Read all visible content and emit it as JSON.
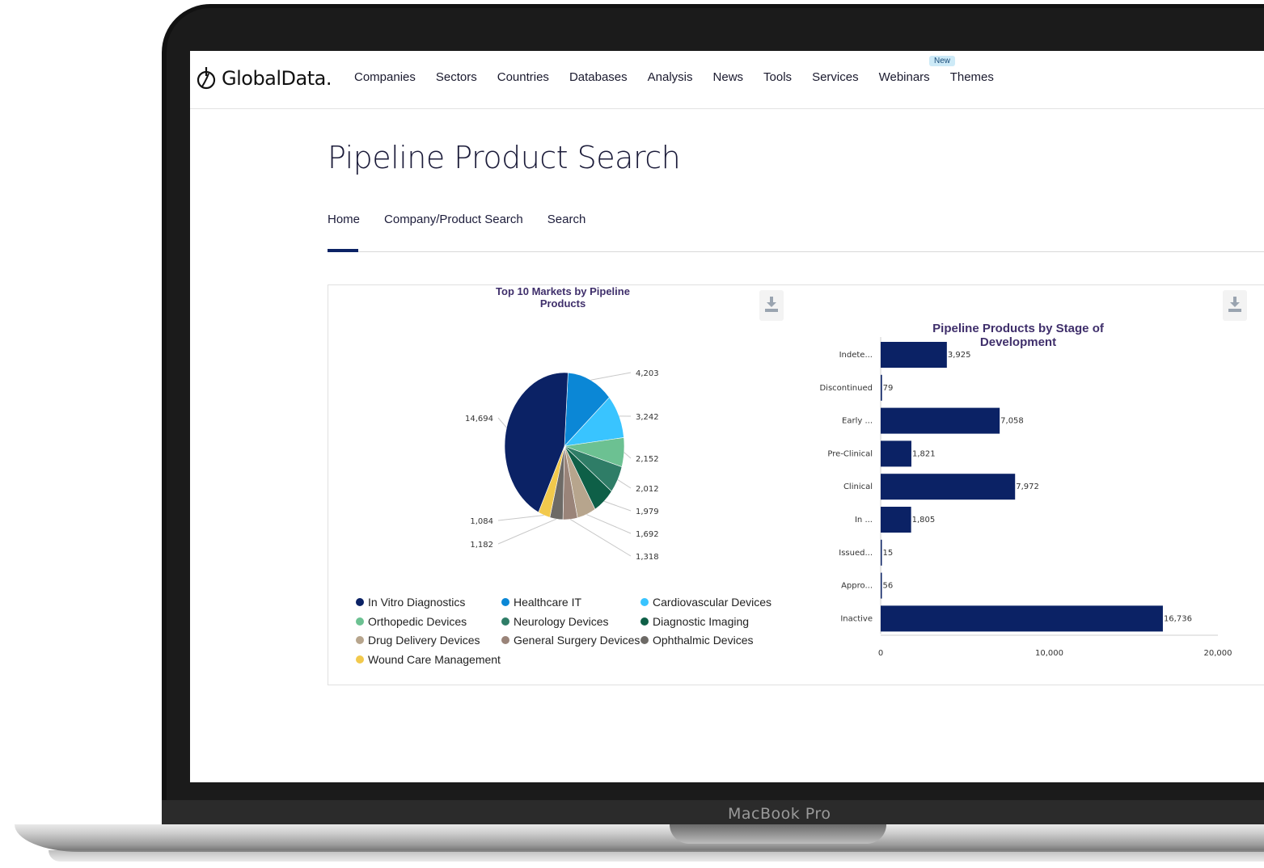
{
  "device": {
    "label": "MacBook Pro"
  },
  "brand": {
    "logo_text": "GlobalData.",
    "logo_icon": "globe-power-icon"
  },
  "nav": {
    "items": [
      "Companies",
      "Sectors",
      "Countries",
      "Databases",
      "Analysis",
      "News",
      "Tools",
      "Services",
      "Webinars",
      "Themes"
    ],
    "badge": "New"
  },
  "page": {
    "title": "Pipeline Product Search"
  },
  "tabs": {
    "items": [
      "Home",
      "Company/Product Search",
      "Search"
    ],
    "active": "Home"
  },
  "icons": {
    "download": "download-icon"
  },
  "colors": {
    "navy": "#0b2265",
    "title_purple": "#3f2f6b"
  },
  "chart_data": [
    {
      "type": "pie",
      "title": "Top 10 Markets by Pipeline Products",
      "categories": [
        "In Vitro Diagnostics",
        "Healthcare IT",
        "Cardiovascular Devices",
        "Orthopedic Devices",
        "Neurology Devices",
        "Diagnostic Imaging",
        "Drug Delivery Devices",
        "General Surgery Devices",
        "Ophthalmic Devices",
        "Wound Care Management"
      ],
      "values": [
        14694,
        4203,
        3242,
        2152,
        2012,
        1979,
        1692,
        1318,
        1182,
        1084
      ],
      "value_labels": [
        "14,694",
        "4,203",
        "3,242",
        "2,152",
        "2,012",
        "1,979",
        "1,692",
        "1,318",
        "1,182",
        "1,084"
      ],
      "colors": [
        "#0b2265",
        "#0b87d6",
        "#39c4ff",
        "#6cc192",
        "#2f7d67",
        "#0e5f47",
        "#b7a58d",
        "#9a8479",
        "#6d6a66",
        "#f2c94c"
      ],
      "legend": "bottom"
    },
    {
      "type": "bar",
      "orientation": "horizontal",
      "title": "Pipeline Products by Stage of Development",
      "categories": [
        "Indete...",
        "Discontinued",
        "Early ...",
        "Pre-Clinical",
        "Clinical",
        "In ...",
        "Issued...",
        "Appro...",
        "Inactive"
      ],
      "values": [
        3925,
        79,
        7058,
        1821,
        7972,
        1805,
        15,
        56,
        16736
      ],
      "value_labels": [
        "3,925",
        "79",
        "7,058",
        "1,821",
        "7,972",
        "1,805",
        "15",
        "56",
        "16,736"
      ],
      "xlim": [
        0,
        20000
      ],
      "xticks": [
        "0",
        "10,000",
        "20,000"
      ],
      "color": "#0b2265",
      "grid": false
    }
  ]
}
